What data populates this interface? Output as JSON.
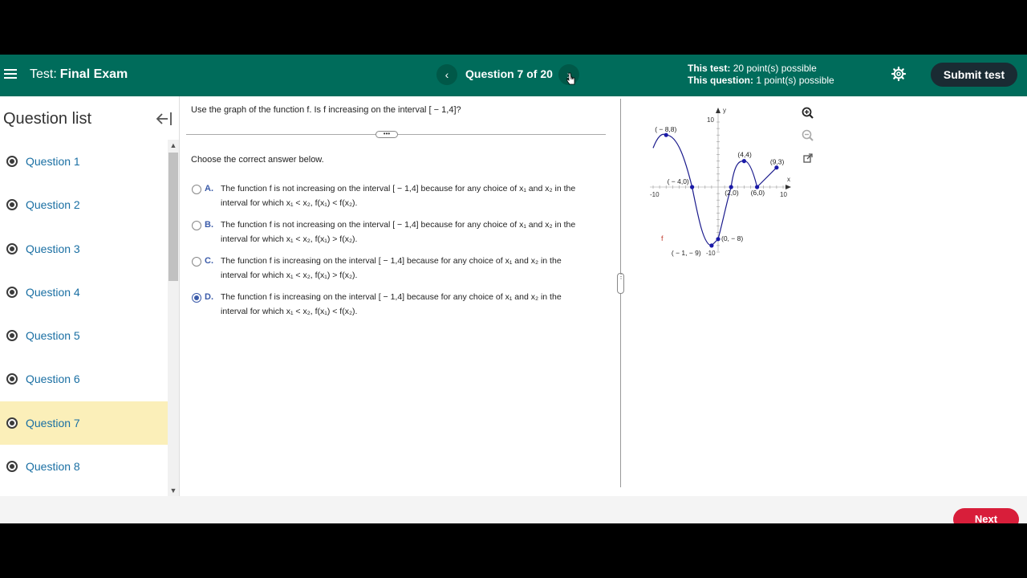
{
  "header": {
    "test_label": "Test:",
    "test_name": "Final Exam",
    "prev_icon": "chevron-left-icon",
    "next_icon": "chevron-right-icon",
    "question_counter": "Question 7 of 20",
    "this_test_label": "This test:",
    "this_test_value": "20 point(s) possible",
    "this_question_label": "This question:",
    "this_question_value": "1 point(s) possible",
    "submit_label": "Submit test"
  },
  "sidebar": {
    "title": "Question list",
    "items": [
      {
        "label": "Question 1"
      },
      {
        "label": "Question 2"
      },
      {
        "label": "Question 3"
      },
      {
        "label": "Question 4"
      },
      {
        "label": "Question 5"
      },
      {
        "label": "Question 6"
      },
      {
        "label": "Question 7",
        "active": true
      },
      {
        "label": "Question 8"
      }
    ]
  },
  "question": {
    "prompt": "Use the graph of the function f. Is f increasing on the interval [ − 1,4]?",
    "instruction": "Choose the correct answer below.",
    "options": [
      {
        "letter": "A.",
        "line1": "The function f is not increasing on the interval [ − 1,4] because for any choice of x₁ and x₂ in the",
        "line2": "interval for which x₁ < x₂, f(x₁) < f(x₂).",
        "selected": false
      },
      {
        "letter": "B.",
        "line1": "The function f is not increasing on the interval [ − 1,4] because for any choice of x₁ and x₂ in the",
        "line2": "interval for which x₁ < x₂, f(x₁) > f(x₂).",
        "selected": false
      },
      {
        "letter": "C.",
        "line1": "The function f is increasing on the interval [ − 1,4] because for any choice of x₁ and x₂ in the",
        "line2": "interval for which x₁ < x₂, f(x₁) > f(x₂).",
        "selected": false
      },
      {
        "letter": "D.",
        "line1": "The function f is increasing on the interval [ − 1,4] because for any choice of x₁ and x₂ in the",
        "line2": "interval for which x₁ < x₂, f(x₁) < f(x₂).",
        "selected": true
      }
    ]
  },
  "graph": {
    "x_axis_label": "x",
    "y_axis_label": "y",
    "function_label": "f",
    "ticks": {
      "x_min": "-10",
      "x_max": "10",
      "y_max": "10",
      "y_min": "-10"
    },
    "points": [
      {
        "label": "( − 8,8)",
        "x": -8,
        "y": 8
      },
      {
        "label": "( − 4,0)",
        "x": -4,
        "y": 0
      },
      {
        "label": "( − 1, − 9)",
        "x": -1,
        "y": -9
      },
      {
        "label": "(0, − 8)",
        "x": 0,
        "y": -8
      },
      {
        "label": "(2,0)",
        "x": 2,
        "y": 0
      },
      {
        "label": "(4,4)",
        "x": 4,
        "y": 4
      },
      {
        "label": "(6,0)",
        "x": 6,
        "y": 0
      },
      {
        "label": "(9,3)",
        "x": 9,
        "y": 3
      }
    ],
    "curve_color": "#1a1a8c",
    "tools": [
      "zoom-in-icon",
      "zoom-out-icon",
      "popout-icon"
    ]
  },
  "footer": {
    "next_label": "Next"
  },
  "colors": {
    "header_bg": "#006c5b",
    "active_question_bg": "#fbefb9",
    "link_color": "#1a6fa3",
    "next_button": "#d81e3a",
    "submit_button": "#1a2b33"
  }
}
